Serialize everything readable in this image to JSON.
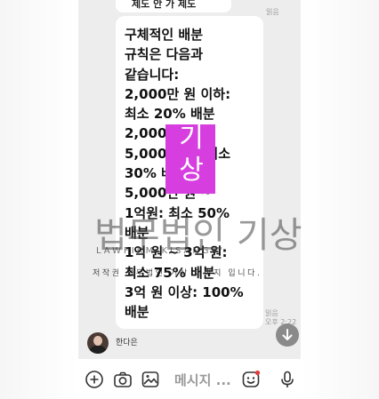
{
  "chat": {
    "prev_message_fragment": "제도 안 가 제도",
    "read_label_top": "읽음",
    "message_text": "구체적인 배분\n규칙은 다음과\n같습니다:\n2,000만 원 이하:\n최소 20% 배분\n2,000만 원 ~\n5,000만 원: 최소\n30% 배분\n5,000만 원 ~\n1억원: 최소 50%\n배분\n1억 원 ~ 3억 원:\n최소 75% 배분\n3억 원 이상: 100%\n배분",
    "read_label_bottom": "읽음",
    "time_label": "오후 2:22",
    "sender_name": "한다은"
  },
  "input_bar": {
    "placeholder": "메시지 ...",
    "icons": [
      "plus-icon",
      "camera-icon",
      "gallery-icon",
      "emoji-icon",
      "mic-icon"
    ]
  },
  "scroll_button": {
    "icon": "arrow-down-icon"
  },
  "watermark": {
    "stamp_text": "기상",
    "logo_text": "법무법인 기상",
    "logo_sub": "LAWFIRM KISANG",
    "copyright_text": "저작권 법무법인 기상 이미지 입니다."
  },
  "colors": {
    "chat_bg": "#ededed",
    "bubble_bg": "#ffffff",
    "stamp": "#d63ee0",
    "notification_dot": "#e23b3b"
  }
}
